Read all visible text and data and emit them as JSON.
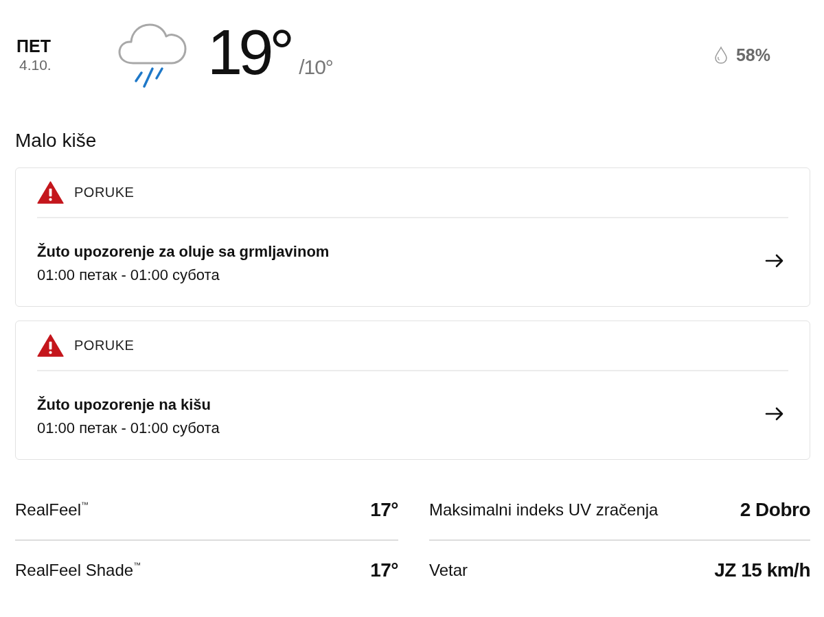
{
  "day": {
    "name": "ПЕТ",
    "date": "4.10."
  },
  "current": {
    "temperature": "19°",
    "low": "/10°",
    "humidity": "58%"
  },
  "condition": "Malo kiše",
  "alerts": [
    {
      "category": "PORUKE",
      "title": "Žuto upozorenje za oluje sa grmljavinom",
      "period": "01:00 петак - 01:00 субота"
    },
    {
      "category": "PORUKE",
      "title": "Žuto upozorenje na kišu",
      "period": "01:00 петак - 01:00 субота"
    }
  ],
  "detail_columns": [
    [
      {
        "label": "RealFeel$^{™}$",
        "value": "17°"
      },
      {
        "label": "RealFeel Shade$^{™}$",
        "value": "17°"
      }
    ],
    [
      {
        "label": "Maksimalni indeks UV zračenja",
        "value": "2 Dobro"
      },
      {
        "label": "Vetar",
        "value": "JZ 15 km/h"
      }
    ]
  ]
}
